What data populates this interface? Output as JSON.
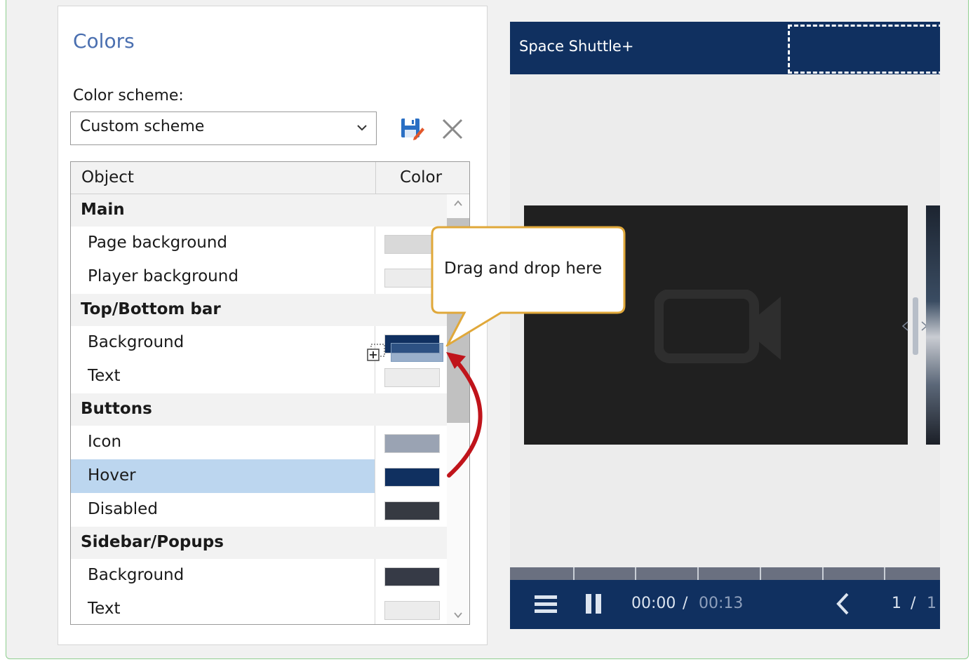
{
  "settings": {
    "title": "Colors",
    "scheme_label": "Color scheme:",
    "scheme_value": "Custom scheme",
    "icons": {
      "dropdown": "chevron-down-icon",
      "save": "save-icon",
      "delete": "close-icon"
    }
  },
  "grid": {
    "header": {
      "object": "Object",
      "color": "Color"
    },
    "groups": [
      {
        "name": "Main",
        "items": [
          {
            "label": "Page background",
            "color": "#d9d9d9"
          },
          {
            "label": "Player background",
            "color": "#ececec"
          }
        ]
      },
      {
        "name": "Top/Bottom bar",
        "items": [
          {
            "label": "Background",
            "color": "#103060"
          },
          {
            "label": "Text",
            "color": "#ececec"
          }
        ]
      },
      {
        "name": "Buttons",
        "items": [
          {
            "label": "Icon",
            "color": "#9aa3b3"
          },
          {
            "label": "Hover",
            "color": "#103060",
            "selected": true
          },
          {
            "label": "Disabled",
            "color": "#363a42"
          }
        ]
      },
      {
        "name": "Sidebar/Popups",
        "items": [
          {
            "label": "Background",
            "color": "#363a46"
          },
          {
            "label": "Text",
            "color": "#ececec"
          }
        ]
      }
    ]
  },
  "callout": {
    "text": "Drag and drop here",
    "border_color": "#e0a83a"
  },
  "arrow_color": "#c0141b",
  "preview": {
    "title": "Space Shuttle+",
    "bar_color": "#103060",
    "time_current": "00:00",
    "time_sep": "/",
    "time_total": "00:13",
    "page_current": "1",
    "page_sep": "/",
    "page_total": "1",
    "icons": [
      "menu-icon",
      "pause-icon",
      "prev-icon",
      "video-camera-icon"
    ]
  }
}
